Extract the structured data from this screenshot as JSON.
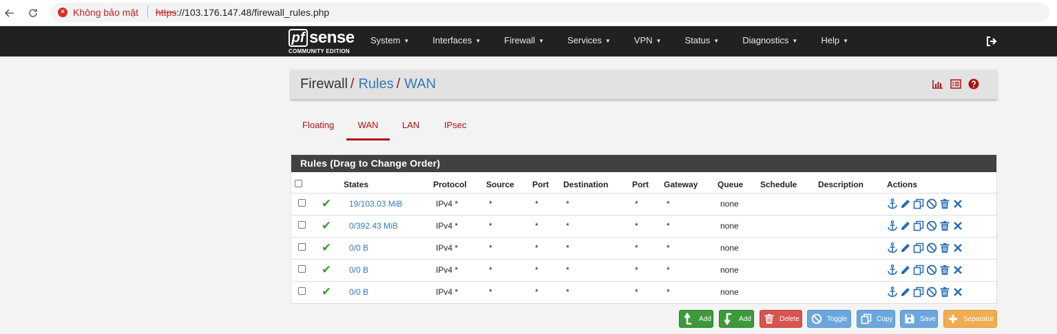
{
  "browser": {
    "security_warning": "Không bảo mật",
    "url_scheme": "https",
    "url_rest": "://103.176.147.48/firewall_rules.php"
  },
  "navbar": {
    "logo_pf": "pf",
    "logo_sense": "sense",
    "logo_edition": "COMMUNITY EDITION",
    "menu": [
      {
        "label": "System"
      },
      {
        "label": "Interfaces"
      },
      {
        "label": "Firewall"
      },
      {
        "label": "Services"
      },
      {
        "label": "VPN"
      },
      {
        "label": "Status"
      },
      {
        "label": "Diagnostics"
      },
      {
        "label": "Help"
      }
    ]
  },
  "breadcrumb": {
    "root": "Firewall",
    "sep": "/",
    "level1": "Rules",
    "level2": "WAN"
  },
  "tabs": [
    {
      "label": "Floating"
    },
    {
      "label": "WAN"
    },
    {
      "label": "LAN"
    },
    {
      "label": "IPsec"
    }
  ],
  "rules_panel": {
    "title": "Rules (Drag to Change Order)",
    "columns": [
      "States",
      "Protocol",
      "Source",
      "Port",
      "Destination",
      "Port",
      "Gateway",
      "Queue",
      "Schedule",
      "Description",
      "Actions"
    ],
    "rows": [
      {
        "states": "19/103.03 MiB",
        "protocol": "IPv4 *",
        "source": "*",
        "sport": "*",
        "destination": "*",
        "dport": "*",
        "gateway": "*",
        "queue": "none",
        "schedule": "",
        "description": ""
      },
      {
        "states": "0/392.43 MiB",
        "protocol": "IPv4 *",
        "source": "*",
        "sport": "*",
        "destination": "*",
        "dport": "*",
        "gateway": "*",
        "queue": "none",
        "schedule": "",
        "description": ""
      },
      {
        "states": "0/0 B",
        "protocol": "IPv4 *",
        "source": "*",
        "sport": "*",
        "destination": "*",
        "dport": "*",
        "gateway": "*",
        "queue": "none",
        "schedule": "",
        "description": ""
      },
      {
        "states": "0/0 B",
        "protocol": "IPv4 *",
        "source": "*",
        "sport": "*",
        "destination": "*",
        "dport": "*",
        "gateway": "*",
        "queue": "none",
        "schedule": "",
        "description": ""
      },
      {
        "states": "0/0 B",
        "protocol": "IPv4 *",
        "source": "*",
        "sport": "*",
        "destination": "*",
        "dport": "*",
        "gateway": "*",
        "queue": "none",
        "schedule": "",
        "description": ""
      }
    ]
  },
  "buttons": {
    "add_top": "Add",
    "add_bottom": "Add",
    "delete": "Delete",
    "toggle": "Toggle",
    "copy": "Copy",
    "save": "Save",
    "separator": "Separator"
  },
  "colors": {
    "accent_red": "#aa1111",
    "link_blue": "#337ab7",
    "navbar_bg": "#212121",
    "check_green": "#3a9a35"
  }
}
